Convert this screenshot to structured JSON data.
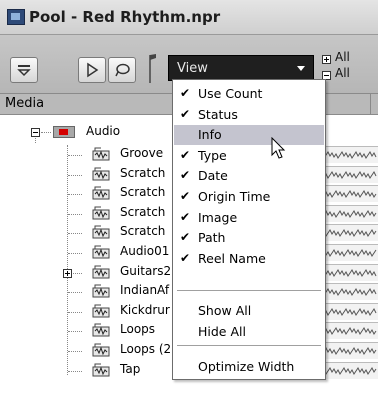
{
  "window": {
    "title": "Pool - Red Rhythm.npr"
  },
  "toolbar": {
    "view_label": "View",
    "expand_all_label": "All",
    "collapse_all_label": "All"
  },
  "column_header": {
    "media_label": "Media"
  },
  "tree": {
    "root_label": "Audio",
    "items": [
      {
        "label": "Groove",
        "expandable": false
      },
      {
        "label": "Scratch",
        "expandable": false
      },
      {
        "label": "Scratch",
        "expandable": false
      },
      {
        "label": "Scratch",
        "expandable": false
      },
      {
        "label": "Scratch",
        "expandable": false
      },
      {
        "label": "Audio01",
        "expandable": false
      },
      {
        "label": "Guitars2",
        "expandable": true
      },
      {
        "label": "IndianAf",
        "expandable": false
      },
      {
        "label": "Kickdrur",
        "expandable": false
      },
      {
        "label": "Loops",
        "expandable": false
      },
      {
        "label": "Loops (2",
        "expandable": false
      },
      {
        "label": "Tap",
        "expandable": false
      }
    ]
  },
  "view_menu": {
    "items": [
      {
        "label": "Use Count",
        "checked": true
      },
      {
        "label": "Status",
        "checked": true
      },
      {
        "label": "Info",
        "checked": false,
        "highlighted": true
      },
      {
        "label": "Type",
        "checked": true
      },
      {
        "label": "Date",
        "checked": true
      },
      {
        "label": "Origin Time",
        "checked": true
      },
      {
        "label": "Image",
        "checked": true
      },
      {
        "label": "Path",
        "checked": true
      },
      {
        "label": "Reel Name",
        "checked": true
      }
    ],
    "show_all": "Show All",
    "hide_all": "Hide All",
    "optimize_width": "Optimize Width",
    "check_glyph": "✔"
  },
  "colors": {
    "highlight": "#c4c4cf",
    "view_select_bg": "#1f1f1f",
    "audio_folder_red": "#d40000"
  }
}
